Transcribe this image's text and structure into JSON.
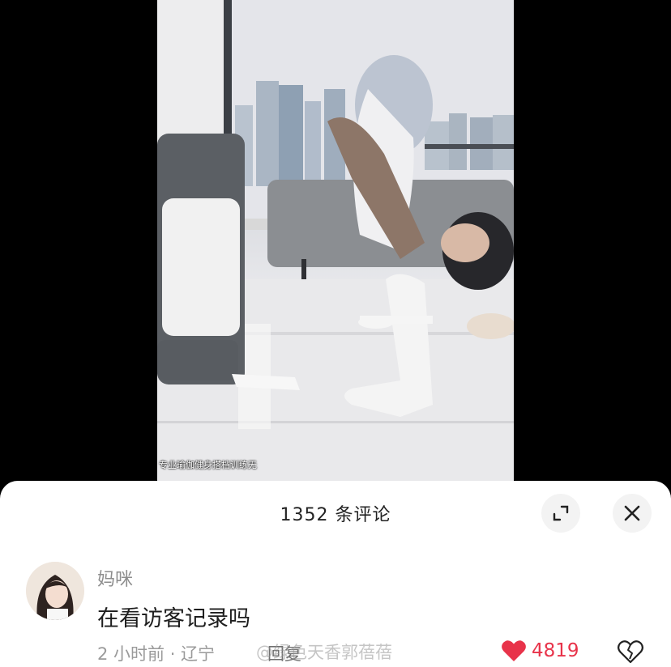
{
  "video": {
    "caption": "专业瑜伽健身搭档训练无"
  },
  "comments_panel": {
    "title": "1352 条评论",
    "expand_icon": "expand-icon",
    "close_icon": "close-icon"
  },
  "comment": {
    "username": "妈咪",
    "text": "在看访客记录吗",
    "time_location": "2 小时前 · 辽宁",
    "reply_label": "回复",
    "watermark": "@绿色天香郭蓓蓓",
    "like_count": "4819",
    "like_color": "#e8334a"
  }
}
